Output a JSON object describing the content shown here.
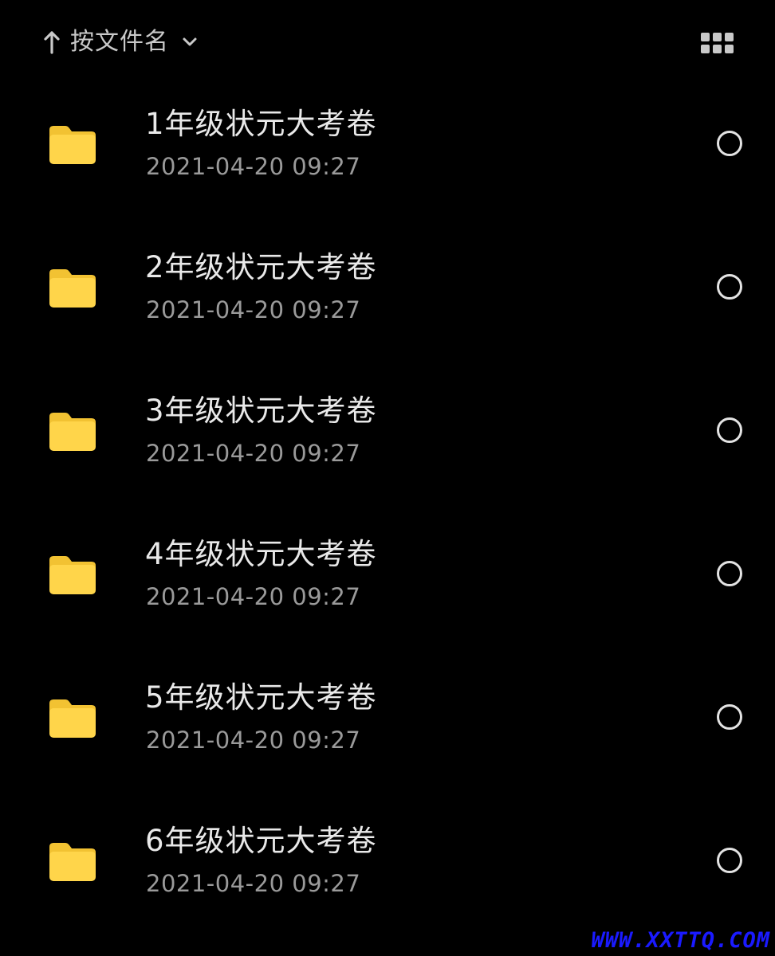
{
  "toolbar": {
    "sort_label": "按文件名",
    "sort_direction_icon": "arrow-up-icon",
    "sort_dropdown_icon": "chevron-down-icon",
    "view_toggle_icon": "grid-view-icon"
  },
  "files": [
    {
      "name": "1年级状元大考卷",
      "date": "2021-04-20 09:27",
      "type_icon": "folder-icon"
    },
    {
      "name": "2年级状元大考卷",
      "date": "2021-04-20 09:27",
      "type_icon": "folder-icon"
    },
    {
      "name": "3年级状元大考卷",
      "date": "2021-04-20 09:27",
      "type_icon": "folder-icon"
    },
    {
      "name": "4年级状元大考卷",
      "date": "2021-04-20 09:27",
      "type_icon": "folder-icon"
    },
    {
      "name": "5年级状元大考卷",
      "date": "2021-04-20 09:27",
      "type_icon": "folder-icon"
    },
    {
      "name": "6年级状元大考卷",
      "date": "2021-04-20 09:27",
      "type_icon": "folder-icon"
    }
  ],
  "watermark": {
    "text": "WWW.XXTTQ.COM",
    "color": "#1a1aff"
  },
  "colors": {
    "background": "#000000",
    "folder": "#FFD54A",
    "folder_tab": "#F2C232",
    "primary_text": "#E9E9E9",
    "secondary_text": "#9A9A9A"
  }
}
